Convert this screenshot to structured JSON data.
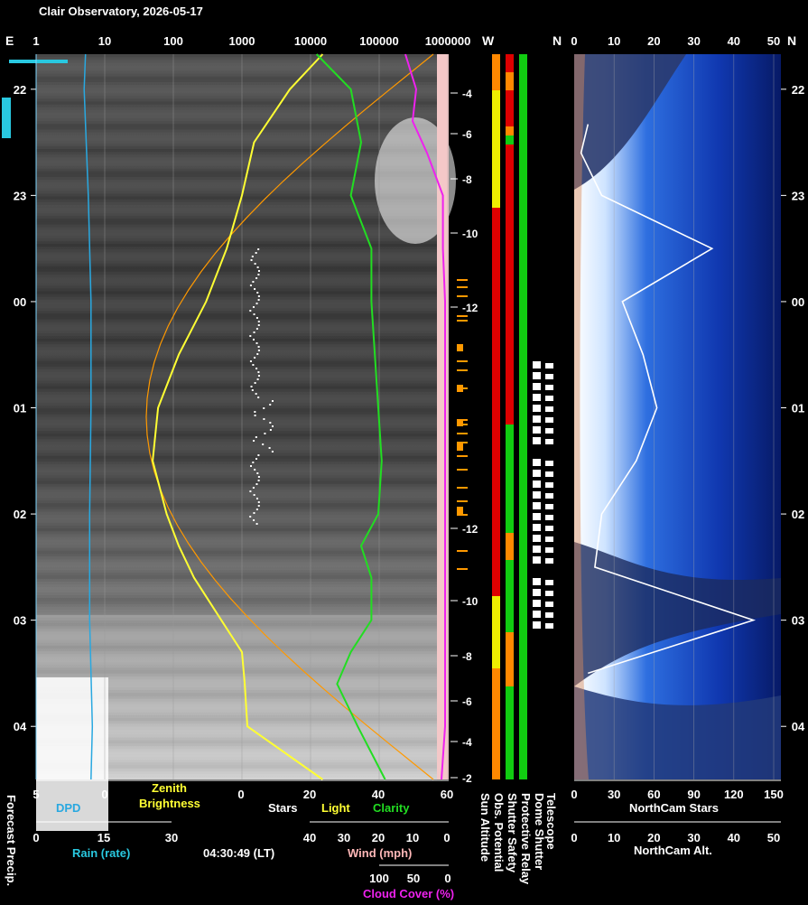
{
  "title": "Clair Observatory, 2026-05-17",
  "time_label": "04:30:49 (LT)",
  "colors": {
    "dpd": "#29a8e0",
    "zenith": "#ffff33",
    "stars": "#ffffff",
    "clarity": "#22dd22",
    "cloud": "#ee22ee",
    "wind": "#ffb8b8",
    "sun_alt": "#ff9900",
    "status_red": "#dd0000",
    "status_green": "#11cc11",
    "status_yellow": "#eeee00",
    "status_orange": "#ff8800"
  },
  "left_panel": {
    "top_edge_letter": "E",
    "top_ticks": [
      "1",
      "10",
      "100",
      "1000",
      "10000",
      "100000",
      "1000000"
    ],
    "time_ticks": [
      "22",
      "23",
      "00",
      "01",
      "02",
      "03",
      "04"
    ],
    "sun_alt_ticks": [
      "-4",
      "-6",
      "-8",
      "-10",
      "-12",
      "-12",
      "-10",
      "-8",
      "-6",
      "-4",
      "-2"
    ],
    "dpd_axis_ticks": [
      "5",
      "0"
    ],
    "zenith_axis_ticks": [
      "0",
      "20",
      "40",
      "60"
    ],
    "rain_axis_ticks": [
      "0",
      "15",
      "30"
    ],
    "wind_axis_ticks": [
      "40",
      "30",
      "20",
      "10",
      "0"
    ],
    "cloud_axis_ticks": [
      "100",
      "50",
      "0"
    ],
    "labels": {
      "forecast_precip": "Forecast Precip.",
      "dpd": "DPD",
      "zenith": "Zenith",
      "brightness": "Brightness",
      "stars": "Stars",
      "light": "Light",
      "clarity": "Clarity",
      "rain": "Rain (rate)",
      "wind": "Wind (mph)",
      "cloud": "Cloud Cover (%)"
    }
  },
  "status_panel": {
    "top_letters": [
      "W",
      "N"
    ],
    "columns": [
      "Sun Altitude",
      "Obs. Potential",
      "Shutter Safety",
      "Protective Relay",
      "Dome Shutter",
      "Telescope"
    ]
  },
  "right_panel": {
    "top_ticks": [
      "0",
      "10",
      "20",
      "30",
      "40",
      "50"
    ],
    "top_edge_letter": "N",
    "time_ticks": [
      "22",
      "23",
      "00",
      "01",
      "02",
      "03",
      "04"
    ],
    "stars_axis_ticks": [
      "0",
      "30",
      "60",
      "90",
      "120",
      "150"
    ],
    "alt_axis_ticks": [
      "0",
      "10",
      "20",
      "30",
      "40",
      "50"
    ],
    "labels": {
      "stars": "NorthCam Stars",
      "alt": "NorthCam Alt."
    }
  },
  "chart_data": [
    {
      "type": "line",
      "title": "Clair Observatory, 2026-05-17",
      "x_unit": "local time (hours)",
      "time_range": [
        "21:40",
        "04:30"
      ],
      "series": [
        {
          "name": "Clarity",
          "x": [
            21.67,
            22.0,
            22.5,
            23.0,
            23.5,
            0.0,
            0.5,
            1.0,
            1.5,
            2.0,
            2.3,
            2.6,
            3.0,
            3.3,
            3.6,
            4.0,
            4.5
          ],
          "values": [
            22,
            32,
            35,
            32,
            38,
            38,
            39,
            40,
            41,
            40,
            35,
            38,
            38,
            32,
            28,
            34,
            42
          ]
        },
        {
          "name": "Zenith Brightness",
          "x": [
            21.67,
            22.0,
            22.5,
            23.0,
            23.5,
            0.0,
            0.5,
            1.0,
            1.5,
            2.0,
            2.3,
            2.6,
            3.0,
            3.3,
            3.6,
            4.0,
            4.5
          ],
          "values": [
            15000,
            5000,
            1500,
            1000,
            600,
            300,
            120,
            60,
            50,
            80,
            120,
            200,
            500,
            1000,
            1100,
            1200,
            15000
          ]
        },
        {
          "name": "Cloud Cover (%)",
          "x": [
            21.67,
            22.0,
            22.3,
            22.6,
            23.0,
            23.5,
            0.0,
            1.0,
            2.0,
            3.0,
            4.0,
            4.5
          ],
          "values": [
            60,
            45,
            50,
            30,
            8,
            8,
            5,
            5,
            5,
            5,
            5,
            10
          ]
        },
        {
          "name": "Rain (rate)",
          "x": [
            21.67,
            0.0,
            1.0,
            2.0,
            3.0,
            4.0,
            4.5
          ],
          "values": [
            0,
            0,
            0,
            0,
            0,
            0,
            0
          ]
        },
        {
          "name": "DPD",
          "x": [
            21.67,
            22.0,
            23.0,
            0.0,
            1.0,
            2.0,
            3.0,
            4.0,
            4.5
          ],
          "values": [
            1.4,
            1.5,
            1.2,
            1.0,
            1.0,
            1.1,
            1.1,
            0.9,
            1.0
          ]
        },
        {
          "name": "NorthCam Stars",
          "x": [
            22.33,
            22.6,
            23.0,
            23.5,
            0.0,
            0.5,
            1.0,
            1.5,
            2.0,
            2.5,
            3.0,
            3.5
          ],
          "values": [
            10,
            5,
            20,
            100,
            35,
            50,
            60,
            45,
            20,
            15,
            130,
            10
          ]
        }
      ]
    }
  ]
}
